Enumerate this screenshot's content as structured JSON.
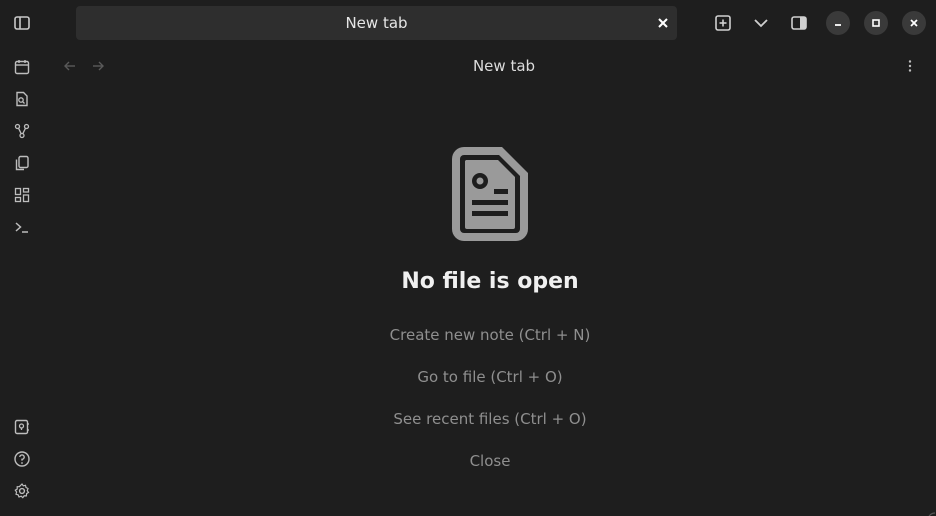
{
  "window": {
    "tab_title": "New tab",
    "view_title": "New tab"
  },
  "toolbar": {
    "icons": [
      "sidebar-toggle-icon",
      "close-icon",
      "new-tab-icon",
      "chevron-down-icon",
      "right-sidebar-icon",
      "minimize-icon",
      "maximize-icon",
      "window-close-icon"
    ]
  },
  "ribbon": {
    "icons": [
      "calendar-icon",
      "file-search-icon",
      "graph-icon",
      "copy-icon",
      "dashboard-icon",
      "terminal-icon",
      "vault-icon",
      "help-icon",
      "settings-icon"
    ]
  },
  "empty_state": {
    "title": "No file is open",
    "actions": [
      "Create new note (Ctrl + N)",
      "Go to file (Ctrl + O)",
      "See recent files (Ctrl + O)",
      "Close"
    ]
  },
  "colors": {
    "background": "#1e1e1e",
    "tab_background": "#2e2e2e",
    "icon": "#bdbdbd",
    "muted_text": "#8f8f8f",
    "title_text": "#f0f0f0"
  }
}
